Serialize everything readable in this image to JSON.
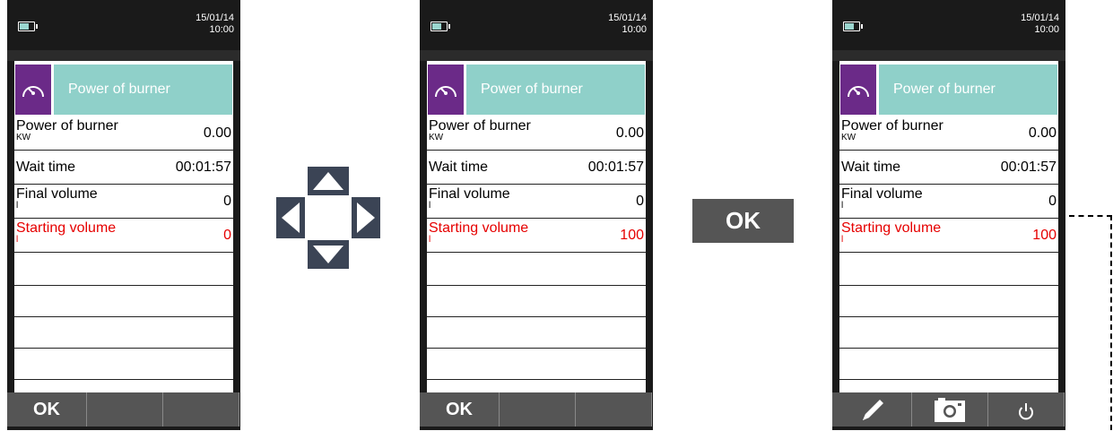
{
  "screens": [
    {
      "date": "15/01/14",
      "time": "10:00",
      "header_title": "Power of burner",
      "rows": [
        {
          "label": "Power of burner",
          "unit": "KW",
          "value": "0.00"
        },
        {
          "label": "Wait time",
          "unit": "",
          "value": "00:01:57"
        },
        {
          "label": "Final volume",
          "unit": "l",
          "value": "0"
        },
        {
          "label": "Starting volume",
          "unit": "l",
          "value": "0",
          "selected": true
        }
      ],
      "buttons": {
        "left": "OK",
        "middle": "",
        "right": ""
      }
    },
    {
      "date": "15/01/14",
      "time": "10:00",
      "header_title": "Power of burner",
      "rows": [
        {
          "label": "Power of burner",
          "unit": "KW",
          "value": "0.00"
        },
        {
          "label": "Wait time",
          "unit": "",
          "value": "00:01:57"
        },
        {
          "label": "Final volume",
          "unit": "l",
          "value": "0"
        },
        {
          "label": "Starting volume",
          "unit": "l",
          "value": "100",
          "selected": true
        }
      ],
      "buttons": {
        "left": "OK",
        "middle": "",
        "right": ""
      }
    },
    {
      "date": "15/01/14",
      "time": "10:00",
      "header_title": "Power of burner",
      "rows": [
        {
          "label": "Power of burner",
          "unit": "KW",
          "value": "0.00"
        },
        {
          "label": "Wait time",
          "unit": "",
          "value": "00:01:57"
        },
        {
          "label": "Final volume",
          "unit": "l",
          "value": "0"
        },
        {
          "label": "Starting volume",
          "unit": "l",
          "value": "100",
          "selected": true
        }
      ],
      "buttons": {
        "left_icon": "pencil-icon",
        "middle_icon": "camera-icon",
        "right_icon": "power-icon"
      }
    }
  ],
  "ok_key_label": "OK",
  "colors": {
    "accent_teal": "#8fd0c9",
    "icon_purple": "#6b2a88",
    "selected_red": "#e60000",
    "button_grey": "#555555",
    "arrow_navy": "#3b4455"
  }
}
